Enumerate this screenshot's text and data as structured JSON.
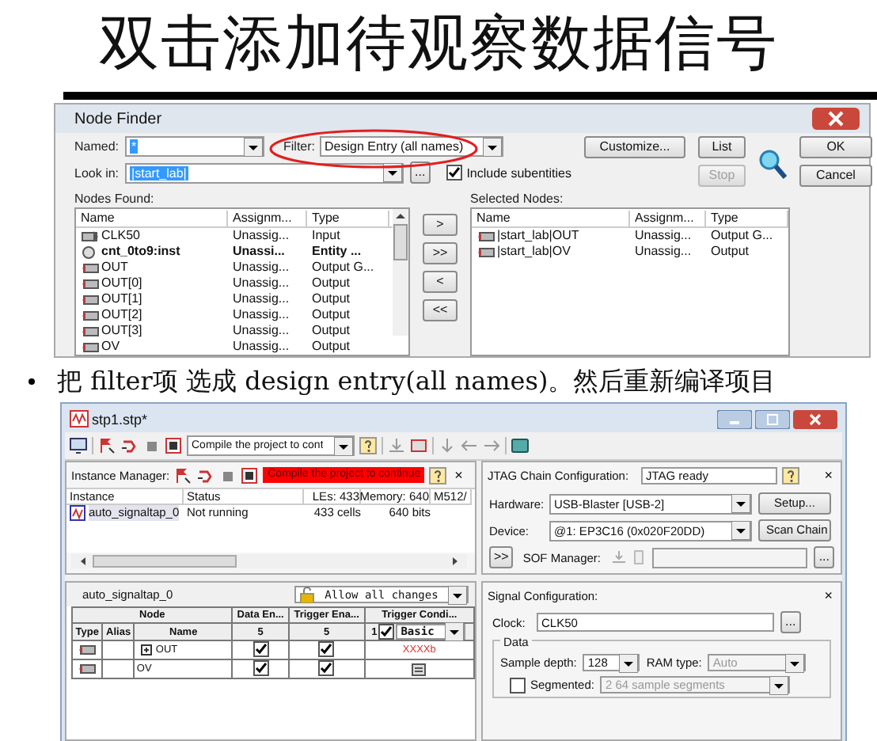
{
  "slide_title": "双击添加待观察数据信号",
  "node_finder": {
    "title": "Node Finder",
    "named": {
      "label": "Named:",
      "value": "*"
    },
    "filter": {
      "label": "Filter:",
      "value": "Design Entry (all names)",
      "highlighted": true
    },
    "look_in": {
      "label": "Look in:",
      "value": "|start_lab|"
    },
    "include_subentities": {
      "label": "Include subentities",
      "checked": true
    },
    "buttons": [
      {
        "label": "Customize...",
        "disabled": false
      },
      {
        "label": "List",
        "disabled": false
      },
      {
        "label": "OK",
        "disabled": false
      },
      {
        "label": "Stop",
        "disabled": true
      },
      {
        "label": "Cancel",
        "disabled": false
      }
    ],
    "browse": "...",
    "nodes_found": {
      "label": "Nodes Found:",
      "columns": [
        "Name",
        "Assignm...",
        "Type"
      ],
      "rows": [
        {
          "kind": "input",
          "cells": [
            "CLK50",
            "Unassig...",
            "Input"
          ]
        },
        {
          "kind": "entity",
          "cells": [
            "cnt_0to9:inst",
            "Unassi...",
            "Entity ..."
          ]
        },
        {
          "kind": "output",
          "cells": [
            "OUT",
            "Unassig...",
            "Output G..."
          ]
        },
        {
          "kind": "output",
          "cells": [
            "OUT[0]",
            "Unassig...",
            "Output"
          ]
        },
        {
          "kind": "output",
          "cells": [
            "OUT[1]",
            "Unassig...",
            "Output"
          ]
        },
        {
          "kind": "output",
          "cells": [
            "OUT[2]",
            "Unassig...",
            "Output"
          ]
        },
        {
          "kind": "output",
          "cells": [
            "OUT[3]",
            "Unassig...",
            "Output"
          ]
        },
        {
          "kind": "output",
          "cells": [
            "OV",
            "Unassig...",
            "Output"
          ]
        }
      ]
    },
    "move_buttons": [
      ">",
      ">>",
      "<",
      "<<"
    ],
    "selected_nodes": {
      "label": "Selected Nodes:",
      "columns": [
        "Name",
        "Assignm...",
        "Type"
      ],
      "rows": [
        {
          "kind": "output",
          "cells": [
            "|start_lab|OUT",
            "Unassig...",
            "Output G..."
          ]
        },
        {
          "kind": "output",
          "cells": [
            "|start_lab|OV",
            "Unassig...",
            "Output"
          ]
        }
      ]
    }
  },
  "bullet": "把 filter项 选成 design entry(all names)。然后重新编译项目",
  "signaltap": {
    "title": "stp1.stp*",
    "toolbar_dropdown": "Compile the project to cont",
    "instance_manager": {
      "label": "Instance Manager:",
      "status": "Compile the project to continue",
      "close": "×",
      "columns": [
        "Instance",
        "Status",
        "LEs: 433",
        "Memory: 640",
        "M512/"
      ],
      "rows": [
        [
          "auto_signaltap_0",
          "Not running",
          "433 cells",
          "640 bits"
        ]
      ]
    },
    "jtag": {
      "label": "JTAG Chain Configuration:",
      "status": "JTAG ready",
      "close": "×",
      "hardware": {
        "label": "Hardware:",
        "value": "USB-Blaster [USB-2]",
        "button": "Setup..."
      },
      "device": {
        "label": "Device:",
        "value": "@1: EP3C16 (0x020F20DD)",
        "button": "Scan Chain"
      },
      "sof": {
        "toggle": ">>",
        "label": "SOF Manager:",
        "browse": "..."
      }
    },
    "setup": {
      "tab": "auto_signaltap_0",
      "lock": "Allow all changes",
      "header": {
        "node": "Node",
        "data_enable": "Data En...",
        "trigger_enable": "Trigger Ena...",
        "trigger_condition": "Trigger Condi..."
      },
      "subheader": {
        "type": "Type",
        "alias": "Alias",
        "name": "Name",
        "data_count": "5",
        "trigger_count": "5",
        "condition_index": "1",
        "condition_enabled": true,
        "condition_mode": "Basic"
      },
      "rows": [
        {
          "name": "OUT",
          "expandable": true,
          "data_enable": true,
          "trigger_enable": true,
          "kind": "value",
          "condition": "XXXXb"
        },
        {
          "name": "OV",
          "expandable": false,
          "data_enable": true,
          "trigger_enable": true,
          "kind": "edge"
        }
      ]
    },
    "signal_config": {
      "label": "Signal Configuration:",
      "close": "×",
      "clock": {
        "label": "Clock:",
        "value": "CLK50",
        "browse": "..."
      },
      "data_group": "Data",
      "sample_depth": {
        "label": "Sample depth:",
        "value": "128"
      },
      "ram_type": {
        "label": "RAM type:",
        "value": "Auto",
        "disabled": true
      },
      "segmented": {
        "label": "Segmented:",
        "checked": false,
        "value": "2  64 sample segments"
      }
    }
  }
}
